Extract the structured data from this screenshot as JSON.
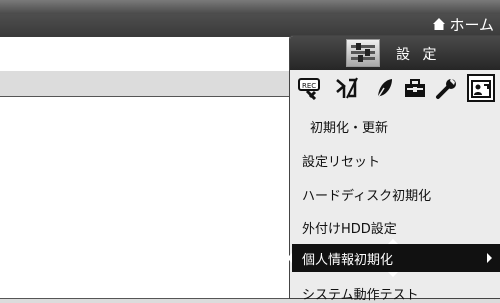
{
  "header": {
    "home_label": "ホーム"
  },
  "menu": {
    "title": "設 定",
    "categories": [
      {
        "icon": "rec-settings-icon"
      },
      {
        "icon": "antenna-settings-icon"
      },
      {
        "icon": "eco-leaf-icon"
      },
      {
        "icon": "toolbox-icon"
      },
      {
        "icon": "wrench-icon"
      },
      {
        "icon": "initialize-update-icon",
        "selected": true
      }
    ],
    "section_title": "初期化・更新",
    "items": [
      {
        "label": "設定リセット"
      },
      {
        "label": "ハードディスク初期化"
      },
      {
        "label": "外付けHDD設定"
      },
      {
        "label": "個人情報初期化",
        "active": true
      },
      {
        "label": "システム動作テスト"
      }
    ]
  },
  "colors": {
    "topbar": "#3a3a3a",
    "menu_bg": "#ececec",
    "active_item_bg": "#111111"
  }
}
